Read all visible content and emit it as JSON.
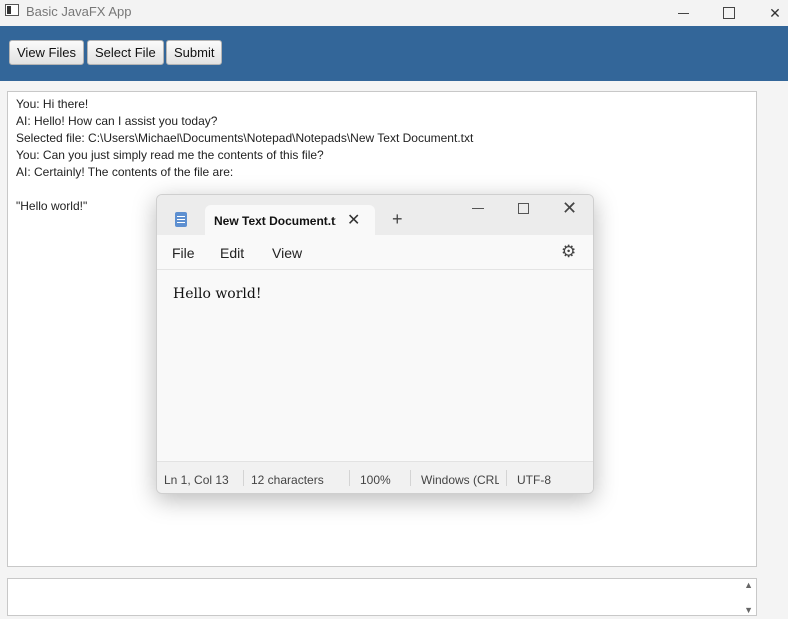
{
  "window": {
    "title": "Basic JavaFX App"
  },
  "toolbar": {
    "view_files": "View Files",
    "select_file": "Select File",
    "submit": "Submit"
  },
  "chat": {
    "lines": [
      "You: Hi there!",
      "AI: Hello! How can I assist you today?",
      "Selected file: C:\\Users\\Michael\\Documents\\Notepad\\Notepads\\New Text Document.txt",
      "You: Can you just simply read me the contents of this file?",
      "AI: Certainly! The contents of the file are:",
      "\"Hello world!\""
    ]
  },
  "input": {
    "value": ""
  },
  "notepad": {
    "tab_title": "New Text Document.txt",
    "plus": "+",
    "menu": {
      "file": "File",
      "edit": "Edit",
      "view": "View"
    },
    "content": "Hello world!",
    "status": {
      "position": "Ln 1, Col 13",
      "characters": "12 characters",
      "zoom": "100%",
      "line_ending": "Windows (CRLF)",
      "encoding": "UTF-8"
    }
  },
  "icons": {
    "app": "javafx-window-icon",
    "notepad": "notepad-icon",
    "settings": "gear-icon"
  }
}
